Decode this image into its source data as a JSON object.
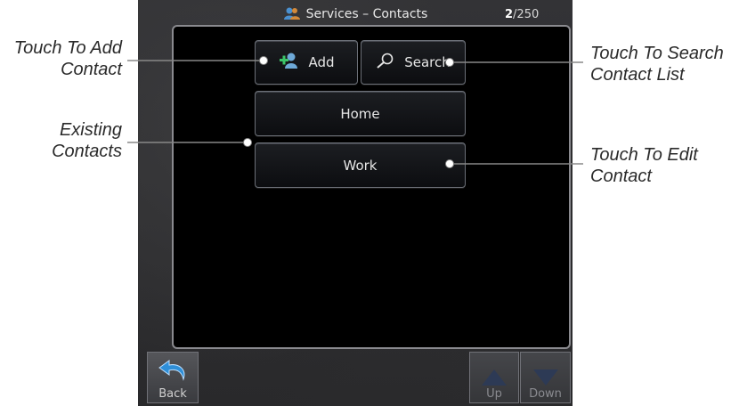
{
  "screen": {
    "title": "Services – Contacts",
    "page_current": "2",
    "page_total": "/250"
  },
  "buttons": {
    "add_label": "Add",
    "search_label": "Search",
    "contacts": [
      {
        "label": "Home"
      },
      {
        "label": "Work"
      }
    ]
  },
  "softkeys": {
    "back": "Back",
    "up": "Up",
    "down": "Down"
  },
  "callouts": {
    "add_line1": "Touch To Add",
    "add_line2": "Contact",
    "existing_line1": "Existing",
    "existing_line2": "Contacts",
    "search_line1": "Touch To Search",
    "search_line2": "Contact List",
    "edit_line1": "Touch To Edit",
    "edit_line2": "Contact"
  },
  "colors": {
    "add_icon": "#2fae5a",
    "accent_text": "#ffffff"
  },
  "icons": [
    "people-icon",
    "add-contact-icon",
    "search-icon",
    "back-arrow-icon",
    "up-arrow-icon",
    "down-arrow-icon"
  ]
}
